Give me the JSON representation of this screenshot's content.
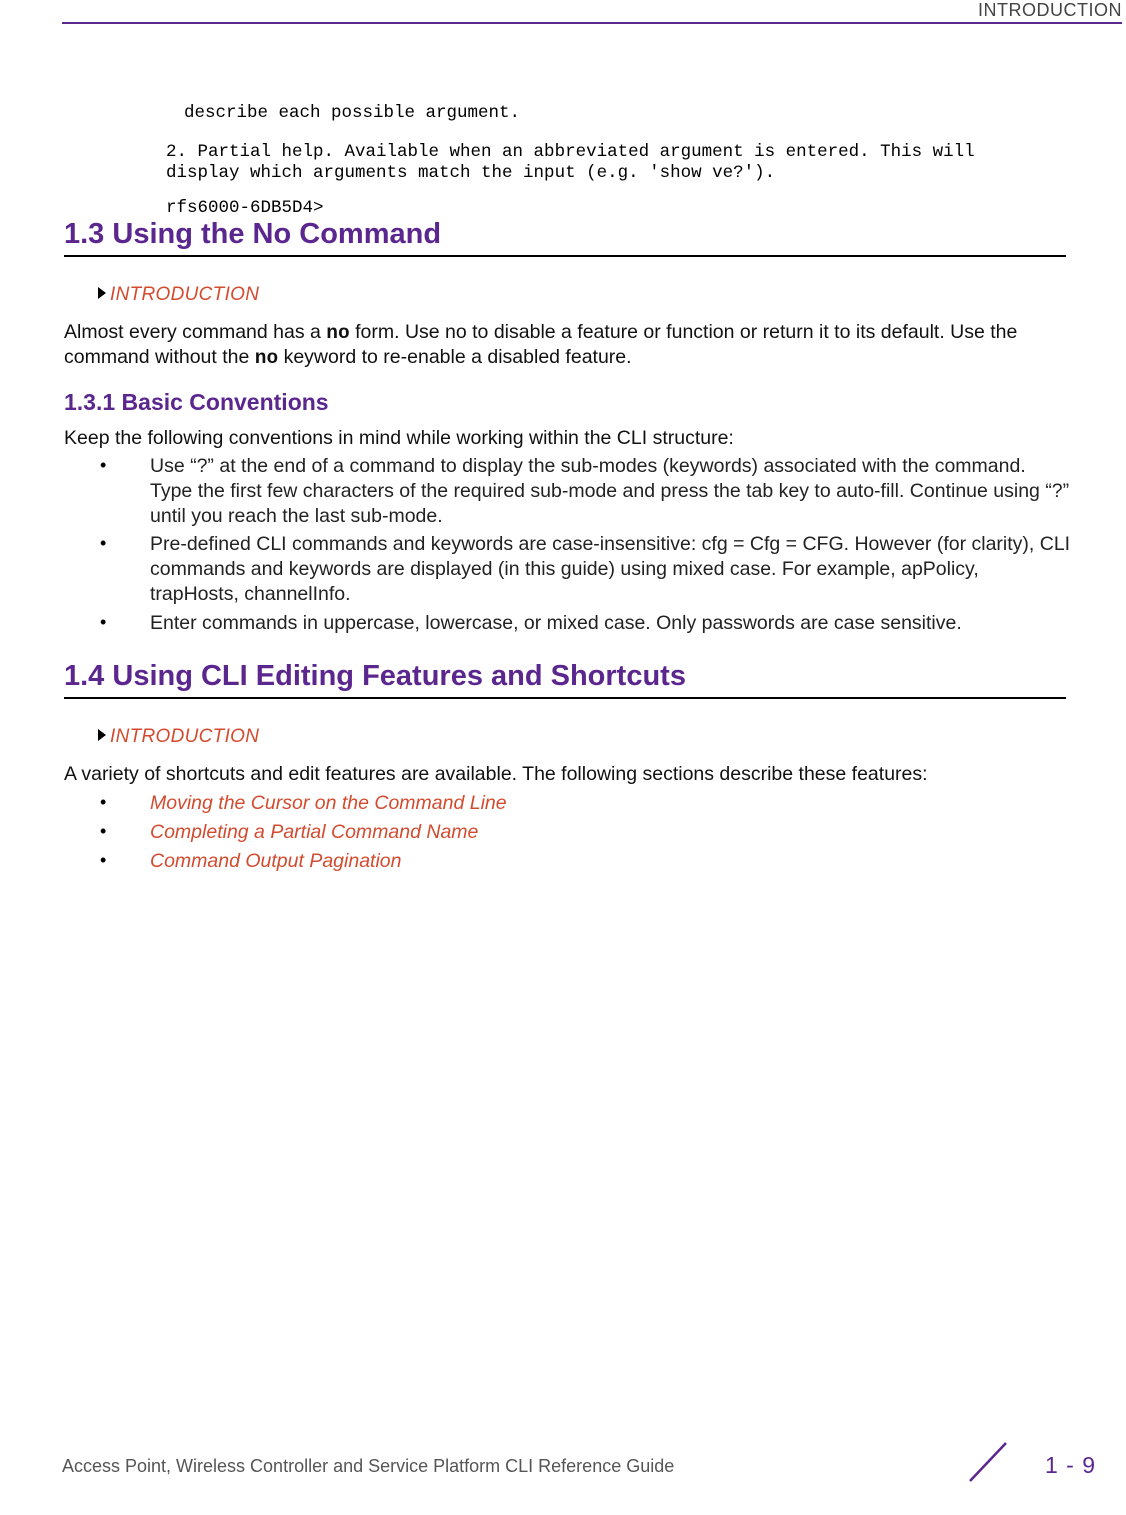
{
  "header": {
    "label": "INTRODUCTION"
  },
  "code": {
    "line1": "describe each possible argument.",
    "line2": "2. Partial help. Available when an abbreviated argument is entered. This will\ndisplay which arguments match the input (e.g. 'show ve?').",
    "line3": "rfs6000-6DB5D4>"
  },
  "sections": {
    "s13": {
      "title": "1.3 Using the No Command",
      "tag": "INTRODUCTION",
      "para_pre": "Almost every command has a ",
      "para_bold1": "no",
      "para_mid": " form. Use no to disable a feature or function or return it to its default. Use the command without the ",
      "para_bold2": "no",
      "para_post": " keyword to re-enable a disabled feature."
    },
    "s131": {
      "title": "1.3.1 Basic Conventions",
      "intro": "Keep the following conventions in mind while working within the CLI structure:",
      "bullets": [
        "Use “?” at the end of a command to display the sub-modes (keywords) associated with the command. Type the first few characters of the required sub-mode and press the tab key to auto-fill. Continue using “?” until you reach the last sub-mode.",
        "Pre-defined CLI commands and keywords are case-insensitive: cfg = Cfg = CFG. However (for clarity), CLI commands and keywords are displayed (in this guide) using mixed case. For example, apPolicy, trapHosts, channelInfo.",
        "Enter commands in uppercase, lowercase, or mixed case. Only passwords are case sensitive."
      ]
    },
    "s14": {
      "title": "1.4 Using CLI Editing Features and Shortcuts",
      "tag": "INTRODUCTION",
      "intro": "A variety of shortcuts and edit features are available. The following sections describe these features:",
      "links": [
        "Moving the Cursor on the Command Line",
        "Completing a Partial Command Name",
        "Command Output Pagination"
      ]
    }
  },
  "footer": {
    "title": "Access Point, Wireless Controller and Service Platform CLI Reference Guide",
    "page": "1 - 9"
  }
}
